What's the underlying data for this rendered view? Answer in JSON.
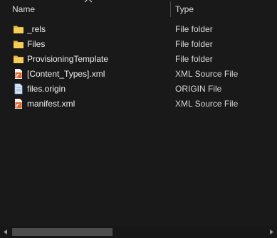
{
  "header": {
    "name_label": "Name",
    "type_label": "Type",
    "sort_icon": "chevron-up-icon"
  },
  "files": [
    {
      "name": "_rels",
      "type": "File folder",
      "icon": "folder-icon"
    },
    {
      "name": "Files",
      "type": "File folder",
      "icon": "folder-icon"
    },
    {
      "name": "ProvisioningTemplate",
      "type": "File folder",
      "icon": "folder-icon"
    },
    {
      "name": "[Content_Types].xml",
      "type": "XML Source File",
      "icon": "xml-file-icon"
    },
    {
      "name": "files.origin",
      "type": "ORIGIN File",
      "icon": "generic-file-icon"
    },
    {
      "name": "manifest.xml",
      "type": "XML Source File",
      "icon": "xml-file-icon"
    }
  ],
  "colors": {
    "background": "#191919",
    "folder": "#f2c94c",
    "xml_icon": "#e07b39",
    "scrollbar_thumb": "#4d4d4d"
  }
}
